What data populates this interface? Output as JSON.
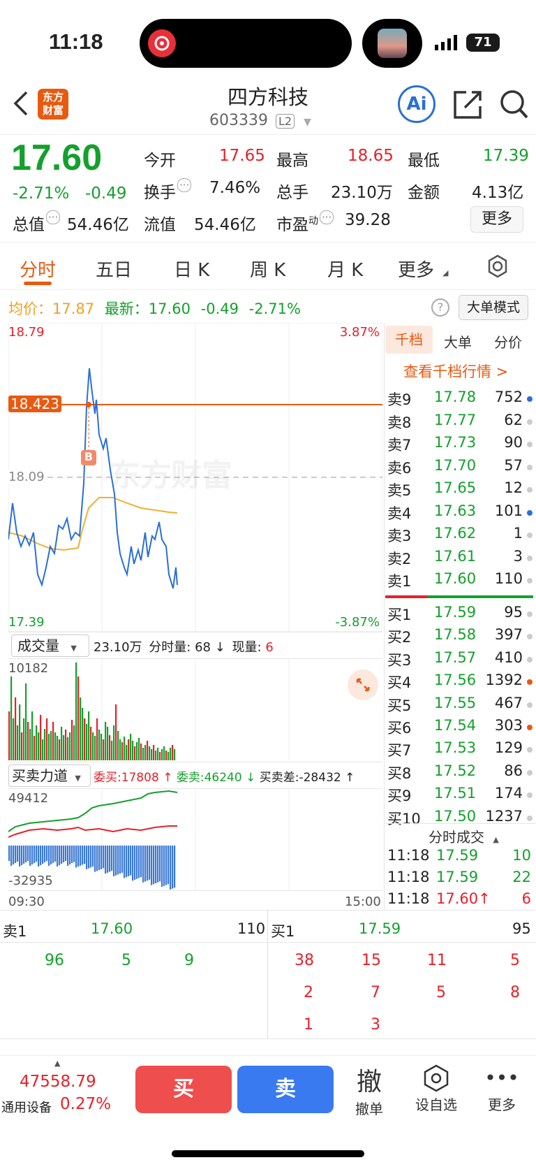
{
  "status": {
    "time": "11:18",
    "battery": "71"
  },
  "header": {
    "title": "四方科技",
    "code": "603339",
    "level_badge": "L2",
    "logo_text_1": "东方",
    "logo_text_2": "财富",
    "ai_label": "Ai"
  },
  "quote": {
    "price": "17.60",
    "change_pct": "-2.71%",
    "change": "-0.49",
    "open_label": "今开",
    "open": "17.65",
    "high_label": "最高",
    "high": "18.65",
    "low_label": "最低",
    "low": "17.39",
    "turnover_label": "换手",
    "turnover": "7.46%",
    "volume_label": "总手",
    "volume": "23.10万",
    "amount_label": "金额",
    "amount": "4.13亿",
    "mktcap_label": "总值",
    "mktcap": "54.46亿",
    "float_label": "流值",
    "float_cap": "54.46亿",
    "pe_label": "市盈",
    "pe_sup": "动",
    "pe": "39.28",
    "more_button": "更多"
  },
  "tabs": [
    "分时",
    "五日",
    "日 K",
    "周 K",
    "月 K",
    "更多"
  ],
  "info_line": {
    "avg_label": "均价：",
    "avg": "17.87",
    "latest_label": "最新：",
    "latest": "17.60",
    "chg": "-0.49",
    "pct": "-2.71%",
    "mode_button": "大单模式"
  },
  "chart_labels": {
    "top_price": "18.79",
    "top_pct": "3.87%",
    "bottom_price": "17.39",
    "bottom_pct": "-3.87%",
    "mid_price": "18.09",
    "marker_price": "18.423",
    "b_marker": "B",
    "watermark": "东方财富"
  },
  "volume_panel": {
    "selector": "成交量",
    "total": "23.10万",
    "time_vol_label": "分时量:",
    "time_vol": "68 ↓",
    "now_vol_label": "现量:",
    "now_vol": "6",
    "max": "10182"
  },
  "force_panel": {
    "selector": "买卖力道",
    "buy_label": "委买:",
    "buy": "17808 ↑",
    "sell_label": "委卖:",
    "sell": "46240 ↓",
    "diff_label": "买卖差:",
    "diff": "-28432 ↑",
    "top": "49412",
    "bottom": "-32935",
    "time_start": "09:30",
    "time_end": "15:00"
  },
  "orderbook": {
    "tabs": [
      "千档",
      "大单",
      "分价"
    ],
    "link": "查看千档行情 >",
    "asks": [
      {
        "label": "卖9",
        "price": "17.78",
        "vol": "752",
        "dot": "#2a6fd6"
      },
      {
        "label": "卖8",
        "price": "17.77",
        "vol": "62",
        "dot": "#cccccc"
      },
      {
        "label": "卖7",
        "price": "17.73",
        "vol": "90",
        "dot": "#cccccc"
      },
      {
        "label": "卖6",
        "price": "17.70",
        "vol": "57",
        "dot": "#cccccc"
      },
      {
        "label": "卖5",
        "price": "17.65",
        "vol": "12",
        "dot": "#cccccc"
      },
      {
        "label": "卖4",
        "price": "17.63",
        "vol": "101",
        "dot": "#2a6fd6"
      },
      {
        "label": "卖3",
        "price": "17.62",
        "vol": "1",
        "dot": "#cccccc"
      },
      {
        "label": "卖2",
        "price": "17.61",
        "vol": "3",
        "dot": "#cccccc"
      },
      {
        "label": "卖1",
        "price": "17.60",
        "vol": "110",
        "dot": "#cccccc"
      }
    ],
    "bids": [
      {
        "label": "买1",
        "price": "17.59",
        "vol": "95",
        "dot": "#cccccc"
      },
      {
        "label": "买2",
        "price": "17.58",
        "vol": "397",
        "dot": "#cccccc"
      },
      {
        "label": "买3",
        "price": "17.57",
        "vol": "410",
        "dot": "#cccccc"
      },
      {
        "label": "买4",
        "price": "17.56",
        "vol": "1392",
        "dot": "#e85a10"
      },
      {
        "label": "买5",
        "price": "17.55",
        "vol": "467",
        "dot": "#cccccc"
      },
      {
        "label": "买6",
        "price": "17.54",
        "vol": "303",
        "dot": "#e85a10"
      },
      {
        "label": "买7",
        "price": "17.53",
        "vol": "129",
        "dot": "#cccccc"
      },
      {
        "label": "买8",
        "price": "17.52",
        "vol": "86",
        "dot": "#cccccc"
      },
      {
        "label": "买9",
        "price": "17.51",
        "vol": "174",
        "dot": "#cccccc"
      },
      {
        "label": "买10",
        "price": "17.50",
        "vol": "1237",
        "dot": "#cccccc"
      }
    ],
    "trades_title": "分时成交",
    "trades": [
      {
        "time": "11:18",
        "price": "17.59",
        "vol": "10"
      },
      {
        "time": "11:18",
        "price": "17.59",
        "vol": "22"
      },
      {
        "time": "11:18",
        "price": "17.60↑",
        "vol": "6"
      }
    ]
  },
  "queue": {
    "sell_label": "卖1",
    "sell_price": "17.60",
    "sell_vol": "110",
    "buy_label": "买1",
    "buy_price": "17.59",
    "buy_vol": "95",
    "sell_orders": [
      "96",
      "5",
      "9"
    ],
    "buy_orders": [
      "38",
      "15",
      "11",
      "5",
      "2",
      "7",
      "5",
      "8",
      "1",
      "3"
    ]
  },
  "bottom": {
    "index": "47558.79",
    "index_name": "通用设备",
    "index_pct": "0.27%",
    "buy": "买",
    "sell": "卖",
    "cancel_icon_text": "撤",
    "cancel": "撤单",
    "watch": "设自选",
    "more": "更多"
  },
  "colors": {
    "up": "#e8202a",
    "down": "#14a02c",
    "accent": "#e85a10",
    "line": "#2a6fd6",
    "avg": "#f0b030",
    "buy_btn": "#ef4e4e",
    "sell_btn": "#3a7af0"
  }
}
